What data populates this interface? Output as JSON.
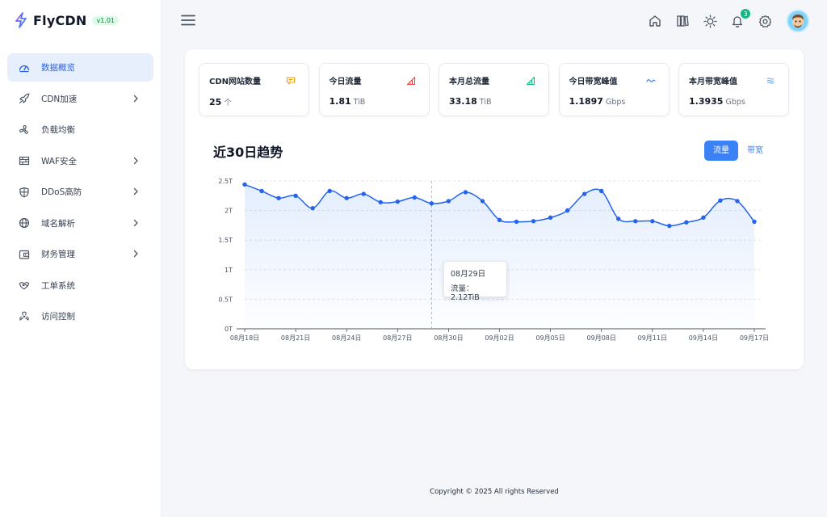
{
  "brand": {
    "name": "FlyCDN",
    "version": "v1.01"
  },
  "sidebar": {
    "items": [
      {
        "label": "数据概览",
        "icon": "dashboard-icon",
        "active": true,
        "expandable": false
      },
      {
        "label": "CDN加速",
        "icon": "rocket-icon",
        "active": false,
        "expandable": true
      },
      {
        "label": "负载均衡",
        "icon": "fan-icon",
        "active": false,
        "expandable": false
      },
      {
        "label": "WAF安全",
        "icon": "firewall-icon",
        "active": false,
        "expandable": true
      },
      {
        "label": "DDoS高防",
        "icon": "shield-icon",
        "active": false,
        "expandable": true
      },
      {
        "label": "域名解析",
        "icon": "globe-icon",
        "active": false,
        "expandable": true
      },
      {
        "label": "财务管理",
        "icon": "wallet-icon",
        "active": false,
        "expandable": true
      },
      {
        "label": "工单系统",
        "icon": "handshake-icon",
        "active": false,
        "expandable": false
      },
      {
        "label": "访问控制",
        "icon": "access-icon",
        "active": false,
        "expandable": false
      }
    ]
  },
  "header": {
    "icons": [
      "home-icon",
      "books-icon",
      "sun-icon",
      "bell-icon",
      "settings-icon"
    ],
    "notification_count": "3"
  },
  "stats": [
    {
      "label": "CDN网站数量",
      "value": "25",
      "unit": "个",
      "icon": "message-icon",
      "icon_color": "#f59e0b"
    },
    {
      "label": "今日流量",
      "value": "1.81",
      "unit": "TiB",
      "icon": "signal-icon",
      "icon_color": "#ef4444"
    },
    {
      "label": "本月总流量",
      "value": "33.18",
      "unit": "TiB",
      "icon": "signal-icon",
      "icon_color": "#10b981"
    },
    {
      "label": "今日带宽峰值",
      "value": "1.1897",
      "unit": "Gbps",
      "icon": "wave-icon",
      "icon_color": "#3b82f6"
    },
    {
      "label": "本月带宽峰值",
      "value": "1.3935",
      "unit": "Gbps",
      "icon": "waves-icon",
      "icon_color": "#60a5fa"
    }
  ],
  "chart_section": {
    "title": "近30日趋势",
    "toggle": {
      "active": "流量",
      "inactive": "带宽"
    }
  },
  "tooltip": {
    "date": "08月29日",
    "text": "流量： 2.12TiB"
  },
  "chart_data": {
    "type": "area",
    "series": [
      {
        "name": "流量",
        "color": "#2563eb"
      }
    ],
    "y_ticks": [
      "0T",
      "0.5T",
      "1T",
      "1.5T",
      "2T",
      "2.5T"
    ],
    "ylim": [
      0,
      2.5
    ],
    "x_tick_labels": [
      "08月18日",
      "08月21日",
      "08月24日",
      "08月27日",
      "08月30日",
      "09月02日",
      "09月05日",
      "09月08日",
      "09月11日",
      "09月14日",
      "09月17日"
    ],
    "x": [
      "08-18",
      "08-19",
      "08-20",
      "08-21",
      "08-22",
      "08-23",
      "08-24",
      "08-25",
      "08-26",
      "08-27",
      "08-28",
      "08-29",
      "08-30",
      "08-31",
      "09-01",
      "09-02",
      "09-03",
      "09-04",
      "09-05",
      "09-06",
      "09-07",
      "09-08",
      "09-09",
      "09-10",
      "09-11",
      "09-12",
      "09-13",
      "09-14",
      "09-15",
      "09-16",
      "09-17"
    ],
    "values": [
      2.44,
      2.33,
      2.21,
      2.25,
      2.04,
      2.33,
      2.21,
      2.28,
      2.14,
      2.15,
      2.22,
      2.12,
      2.16,
      2.31,
      2.16,
      1.84,
      1.81,
      1.82,
      1.88,
      2.0,
      2.28,
      2.33,
      1.86,
      1.82,
      1.82,
      1.74,
      1.8,
      1.88,
      2.17,
      2.16,
      1.81
    ],
    "grid": true
  },
  "footer": {
    "text": "Copyright © 2025 All rights Reserved"
  }
}
